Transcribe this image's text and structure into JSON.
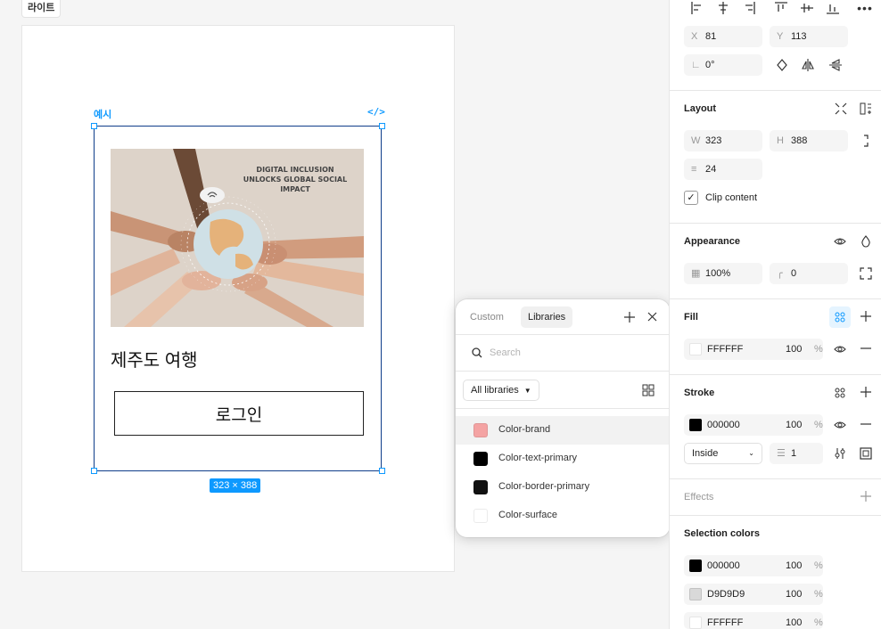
{
  "canvas": {
    "page_tag": "라이트",
    "component_label": "예시",
    "code_icon": "</>",
    "size_badge": "323 × 388"
  },
  "card": {
    "image_caption": "DIGITAL INCLUSION UNLOCKS GLOBAL SOCIAL IMPACT",
    "title": "제주도 여행",
    "button_label": "로그인"
  },
  "library_popup": {
    "tabs": [
      {
        "label": "Custom",
        "active": false
      },
      {
        "label": "Libraries",
        "active": true
      }
    ],
    "search_placeholder": "Search",
    "filter_label": "All libraries",
    "items": [
      {
        "label": "Color-brand",
        "color": "#F4A3A3"
      },
      {
        "label": "Color-text-primary",
        "color": "#000000"
      },
      {
        "label": "Color-border-primary",
        "color": "#111111"
      },
      {
        "label": "Color-surface",
        "color": "#FFFFFF"
      }
    ]
  },
  "properties": {
    "position": {
      "x_label": "X",
      "x": "81",
      "y_label": "Y",
      "y": "113",
      "rotation": "0°"
    },
    "layout": {
      "title": "Layout",
      "w_label": "W",
      "w": "323",
      "h_label": "H",
      "h": "388",
      "gap": "24",
      "clip_content_label": "Clip content",
      "clip_content_checked": true
    },
    "appearance": {
      "title": "Appearance",
      "opacity": "100%",
      "radius": "0"
    },
    "fill": {
      "title": "Fill",
      "hex": "FFFFFF",
      "opacity": "100",
      "pct": "%",
      "color": "#FFFFFF"
    },
    "stroke": {
      "title": "Stroke",
      "hex": "000000",
      "opacity": "100",
      "pct": "%",
      "color": "#000000",
      "position": "Inside",
      "weight": "1"
    },
    "effects": {
      "title": "Effects"
    },
    "selection_colors": {
      "title": "Selection colors",
      "items": [
        {
          "hex": "000000",
          "opacity": "100",
          "pct": "%",
          "color": "#000000"
        },
        {
          "hex": "D9D9D9",
          "opacity": "100",
          "pct": "%",
          "color": "#D9D9D9"
        },
        {
          "hex": "FFFFFF",
          "opacity": "100",
          "pct": "%",
          "color": "#FFFFFF"
        }
      ]
    }
  }
}
